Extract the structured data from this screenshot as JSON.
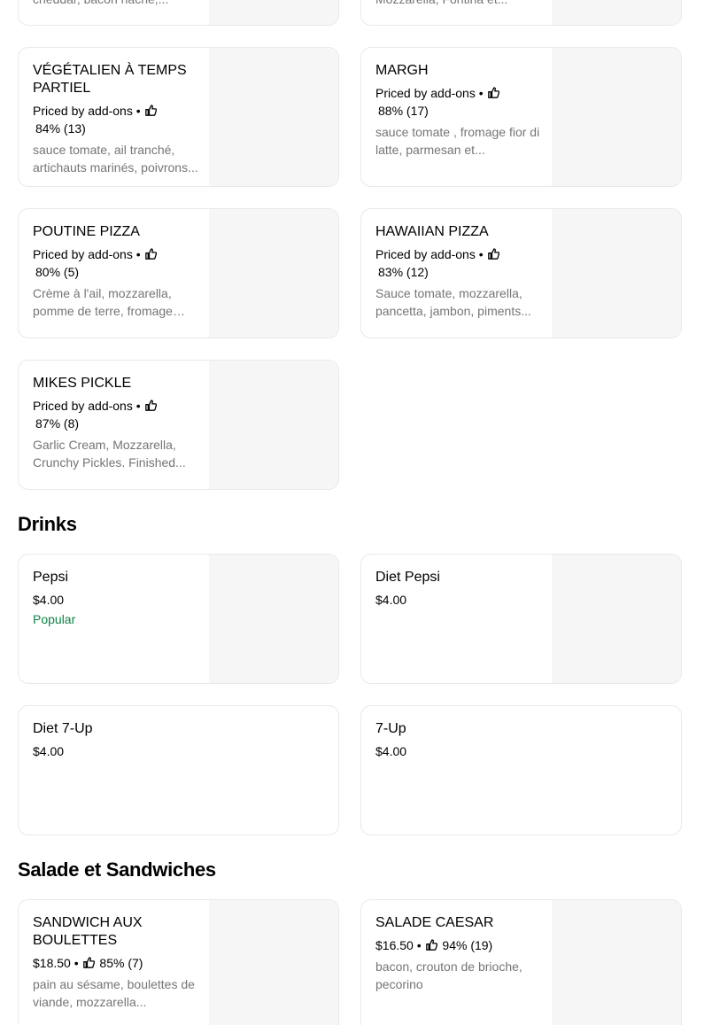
{
  "top_cards": {
    "left_desc": "cheddar, bacon haché,...",
    "right_desc": "Mozzarella, Fontina et..."
  },
  "pizzas": [
    {
      "name": "VÉGÉTALIEN À TEMPS PARTIEL",
      "price": "Priced by add-ons",
      "rating": "84% (13)",
      "desc": "sauce tomate, ail tranché, artichauts marinés, poivrons..."
    },
    {
      "name": "MARGH",
      "price": "Priced by add-ons",
      "rating": "88% (17)",
      "desc": "sauce tomate , fromage fior di latte, parmesan et..."
    },
    {
      "name": "POUTINE PIZZA",
      "price": "Priced by add-ons",
      "rating": "80% (5)",
      "desc": "Crème à l'ail, mozzarella, pomme de terre, fromage en..."
    },
    {
      "name": "HAWAIIAN PIZZA",
      "price": "Priced by add-ons",
      "rating": "83% (12)",
      "desc": "Sauce tomate, mozzarella, pancetta, jambon, piments..."
    },
    {
      "name": "MIKES PICKLE",
      "price": "Priced by add-ons",
      "rating": "87% (8)",
      "desc": "Garlic Cream, Mozzarella, Crunchy Pickles. Finished..."
    }
  ],
  "drinks_section": {
    "title": "Drinks",
    "items": [
      {
        "name": "Pepsi",
        "price": "$4.00",
        "badge": "Popular"
      },
      {
        "name": "Diet Pepsi",
        "price": "$4.00"
      },
      {
        "name": "Diet 7-Up",
        "price": "$4.00"
      },
      {
        "name": "7-Up",
        "price": "$4.00"
      }
    ]
  },
  "salads_section": {
    "title": "Salade et Sandwiches",
    "items": [
      {
        "name": "SANDWICH AUX BOULETTES",
        "price": "$18.50",
        "rating": "85% (7)",
        "desc": "pain au sésame, boulettes de viande, mozzarella..."
      },
      {
        "name": "SALADE CAESAR",
        "price": "$16.50",
        "rating": "94% (19)",
        "desc": "bacon, crouton de brioche, pecorino"
      }
    ]
  },
  "separator": "•",
  "icons": {
    "rating": "thumbs-up-icon"
  },
  "colors": {
    "popular": "#0e8345",
    "muted_text": "#757575",
    "card_border": "#e9e9e9",
    "image_placeholder": "#f6f6f6"
  }
}
